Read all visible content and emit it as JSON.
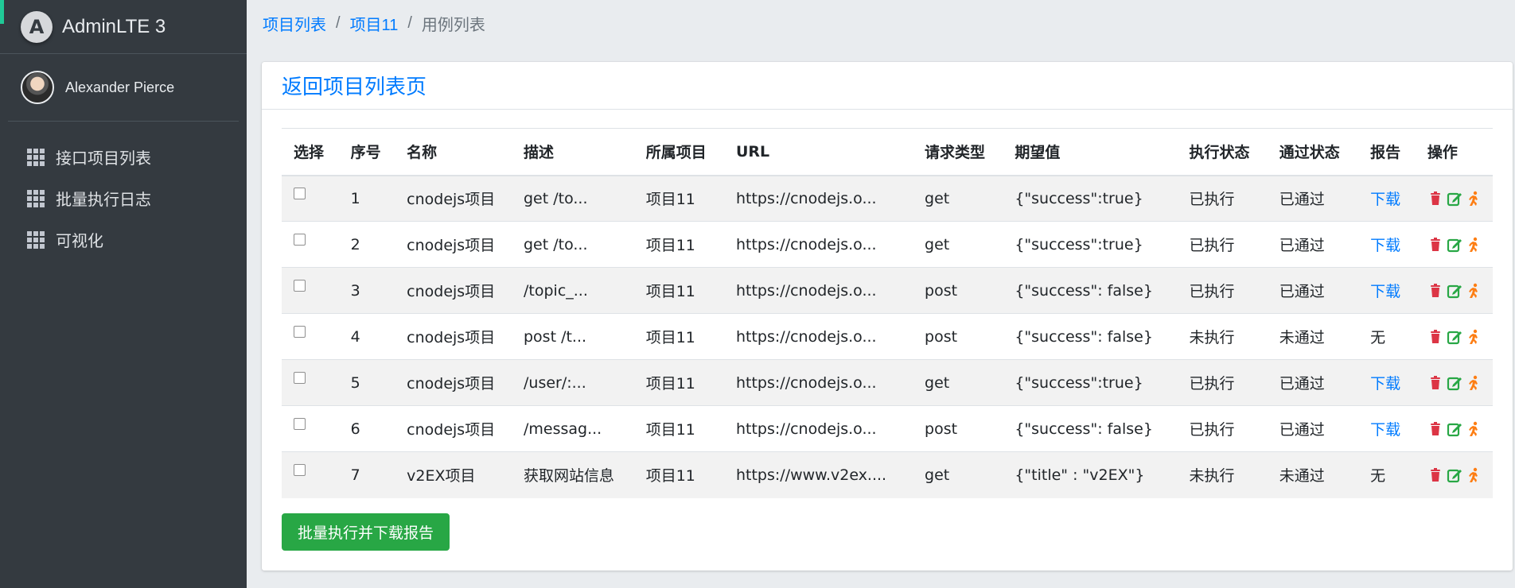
{
  "sidebar": {
    "brand_logo": "A",
    "brand_text": "AdminLTE 3",
    "user_name": "Alexander Pierce",
    "items": [
      {
        "label": "接口项目列表",
        "icon": "grid-icon"
      },
      {
        "label": "批量执行日志",
        "icon": "grid-icon"
      },
      {
        "label": "可视化",
        "icon": "grid-icon"
      }
    ]
  },
  "breadcrumb": {
    "items": [
      "项目列表",
      "项目11",
      "用例列表"
    ],
    "separator": "/"
  },
  "card": {
    "title": "返回项目列表页"
  },
  "table": {
    "headers": [
      "选择",
      "序号",
      "名称",
      "描述",
      "所属项目",
      "URL",
      "请求类型",
      "期望值",
      "执行状态",
      "通过状态",
      "报告",
      "操作"
    ],
    "rows": [
      {
        "id": "1",
        "name": "cnodejs项目",
        "desc": "get /to...",
        "project": "项目11",
        "url": "https://cnodejs.o...",
        "method": "get",
        "expected": "{\"success\":true}",
        "exec": "已执行",
        "pass": "已通过",
        "report": "下载",
        "report_is_link": true
      },
      {
        "id": "2",
        "name": "cnodejs项目",
        "desc": "get /to...",
        "project": "项目11",
        "url": "https://cnodejs.o...",
        "method": "get",
        "expected": "{\"success\":true}",
        "exec": "已执行",
        "pass": "已通过",
        "report": "下载",
        "report_is_link": true
      },
      {
        "id": "3",
        "name": "cnodejs项目",
        "desc": "/topic_...",
        "project": "项目11",
        "url": "https://cnodejs.o...",
        "method": "post",
        "expected": "{\"success\": false}",
        "exec": "已执行",
        "pass": "已通过",
        "report": "下载",
        "report_is_link": true
      },
      {
        "id": "4",
        "name": "cnodejs项目",
        "desc": "post /t...",
        "project": "项目11",
        "url": "https://cnodejs.o...",
        "method": "post",
        "expected": "{\"success\": false}",
        "exec": "未执行",
        "pass": "未通过",
        "report": "无",
        "report_is_link": false
      },
      {
        "id": "5",
        "name": "cnodejs项目",
        "desc": "/user/:...",
        "project": "项目11",
        "url": "https://cnodejs.o...",
        "method": "get",
        "expected": "{\"success\":true}",
        "exec": "已执行",
        "pass": "已通过",
        "report": "下载",
        "report_is_link": true
      },
      {
        "id": "6",
        "name": "cnodejs项目",
        "desc": "/messag...",
        "project": "项目11",
        "url": "https://cnodejs.o...",
        "method": "post",
        "expected": "{\"success\": false}",
        "exec": "已执行",
        "pass": "已通过",
        "report": "下载",
        "report_is_link": true
      },
      {
        "id": "7",
        "name": "v2EX项目",
        "desc": "获取网站信息",
        "project": "项目11",
        "url": "https://www.v2ex....",
        "method": "get",
        "expected": "{\"title\" : \"v2EX\"}",
        "exec": "未执行",
        "pass": "未通过",
        "report": "无",
        "report_is_link": false
      }
    ],
    "op_icons": [
      "trash-icon",
      "edit-icon",
      "run-icon"
    ]
  },
  "actions": {
    "batch_button": "批量执行并下载报告"
  },
  "colors": {
    "sidebar_bg": "#343a40",
    "link": "#007bff",
    "success": "#28a745",
    "danger": "#dc3545",
    "warning": "#fd7e14"
  }
}
